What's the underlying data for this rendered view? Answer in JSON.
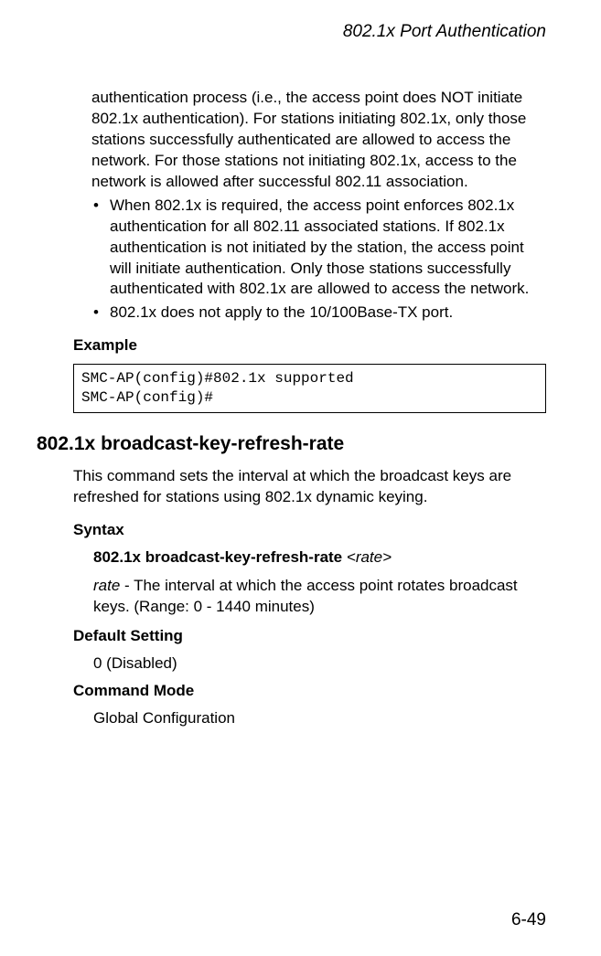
{
  "header": {
    "title": "802.1x Port Authentication"
  },
  "body": {
    "continuation_para": "authentication process (i.e., the access point does NOT initiate 802.1x authentication). For stations initiating 802.1x, only those stations successfully authenticated are allowed to access the network. For those stations not initiating 802.1x, access to the network is allowed after successful 802.11 association.",
    "bullet1": "When 802.1x is required, the access point enforces 802.1x authentication for all 802.11 associated stations. If 802.1x authentication is not initiated by the station, the access point will initiate authentication. Only those stations successfully authenticated with 802.1x are allowed to access the network.",
    "bullet2": "802.1x does not apply to the 10/100Base-TX port.",
    "example_label": "Example",
    "code": "SMC-AP(config)#802.1x supported\nSMC-AP(config)#",
    "section_title": "802.1x broadcast-key-refresh-rate",
    "section_desc": "This command sets the interval at which the broadcast keys are refreshed for stations using 802.1x dynamic keying.",
    "syntax_label": "Syntax",
    "syntax_cmd": "802.1x broadcast-key-refresh-rate",
    "syntax_arg": "<rate>",
    "rate_word": "rate",
    "rate_desc": " - The interval at which the access point rotates broadcast keys. (Range: 0 - 1440 minutes)",
    "default_label": "Default Setting",
    "default_value": "0 (Disabled)",
    "cmdmode_label": "Command Mode",
    "cmdmode_value": "Global Configuration"
  },
  "footer": {
    "page": "6-49"
  }
}
